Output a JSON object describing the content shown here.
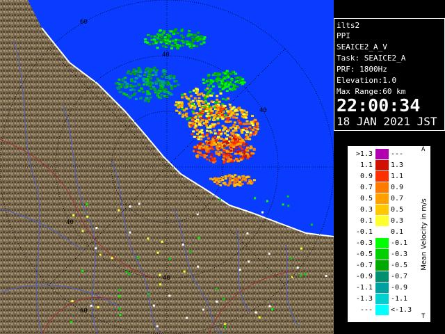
{
  "info_panel": {
    "station": "ilts2",
    "product": "PPI",
    "product_name": "SEAICE2_A_V",
    "task": "Task: SEAICE2_A",
    "prf": "PRF: 1800Hz",
    "elevation": "Elevation:1.0",
    "max_range": "Max Range:60 km",
    "time": "22:00:34",
    "date": "18 JAN 2021 JST"
  },
  "range_rings": {
    "labels": [
      "60",
      "40",
      "40",
      "40",
      "40",
      "60"
    ]
  },
  "legend": {
    "title": "Mean Velocity in m/s",
    "top_glyph": "A",
    "bottom_glyph": "T",
    "rows": [
      {
        "left": ">1.3",
        "right": "---",
        "color": "#b000b0"
      },
      {
        "left": "1.1",
        "right": "1.3",
        "color": "#d01000"
      },
      {
        "left": "0.9",
        "right": "1.1",
        "color": "#ff3000"
      },
      {
        "left": "0.7",
        "right": "0.9",
        "color": "#ff7a00"
      },
      {
        "left": "0.5",
        "right": "0.7",
        "color": "#ffa000"
      },
      {
        "left": "0.3",
        "right": "0.5",
        "color": "#ffc800"
      },
      {
        "left": "0.1",
        "right": "0.3",
        "color": "#ffff30"
      },
      {
        "left": "-0.1",
        "right": "0.1",
        "color": "#ffffff"
      },
      {
        "left": "-0.3",
        "right": "-0.1",
        "color": "#00ff00"
      },
      {
        "left": "-0.5",
        "right": "-0.3",
        "color": "#00d000"
      },
      {
        "left": "-0.7",
        "right": "-0.5",
        "color": "#00a800"
      },
      {
        "left": "-0.9",
        "right": "-0.7",
        "color": "#009070"
      },
      {
        "left": "-1.1",
        "right": "-0.9",
        "color": "#00a0a0"
      },
      {
        "left": "-1.3",
        "right": "-1.1",
        "color": "#00d0d0"
      },
      {
        "left": "---",
        "right": "<-1.3",
        "color": "#00ffff"
      }
    ]
  },
  "colors": {
    "sea": "#0a3cff",
    "land": "#7a6a50",
    "land_dark": "#5a4a34",
    "rings": "#000000",
    "rivers": "#5060c0"
  }
}
